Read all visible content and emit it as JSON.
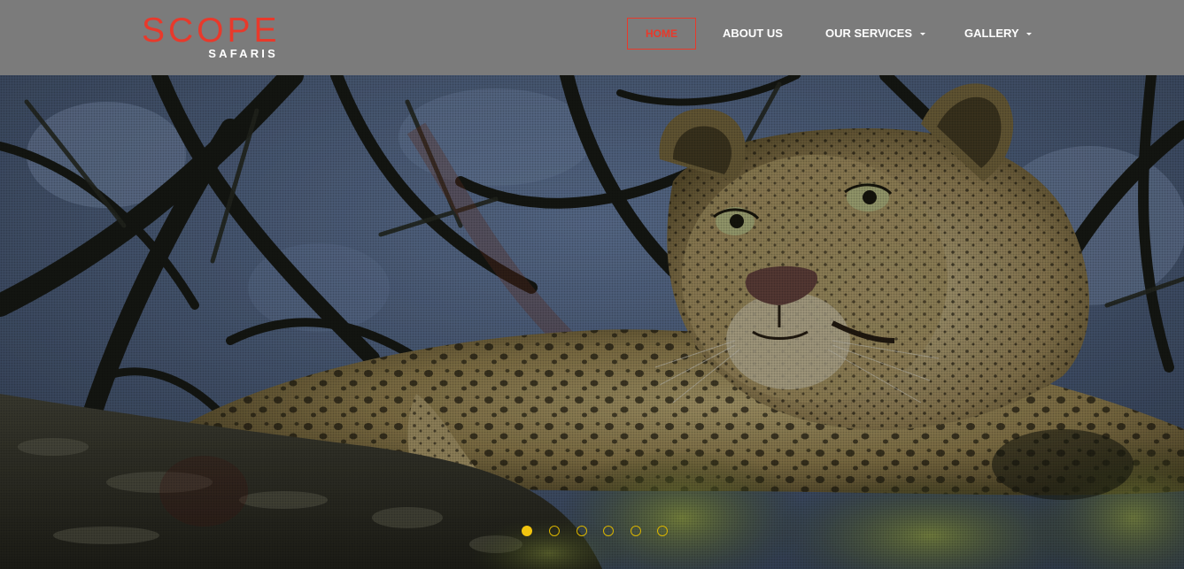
{
  "brand": {
    "name": "SCOPE",
    "tagline": "SAFARIS",
    "color": "#e8392b"
  },
  "nav": {
    "items": [
      {
        "label": "HOME",
        "active": true,
        "dropdown": false
      },
      {
        "label": "ABOUT US",
        "active": false,
        "dropdown": false
      },
      {
        "label": "OUR SERVICES",
        "active": false,
        "dropdown": true
      },
      {
        "label": "GALLERY",
        "active": false,
        "dropdown": true
      }
    ]
  },
  "hero": {
    "image": "leopard-resting-on-tree-branch",
    "slide_count": 6,
    "active_slide": 1,
    "indicator_color": "#f1c40f"
  }
}
